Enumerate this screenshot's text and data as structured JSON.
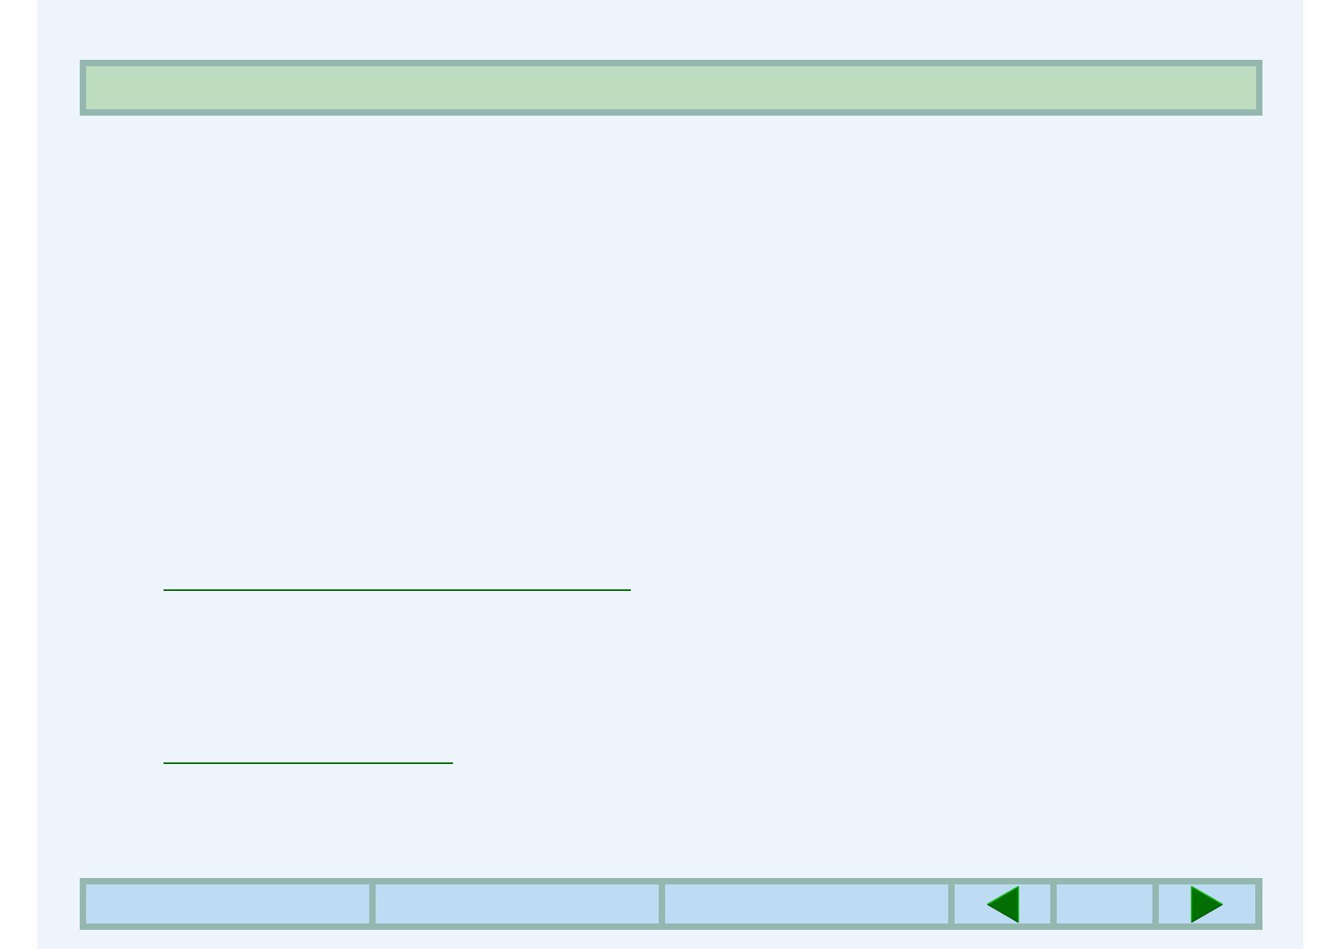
{
  "body": {
    "rules": [
      {
        "kind": "underline"
      },
      {
        "kind": "underline"
      }
    ]
  },
  "footer_bar": {
    "cells": [
      {
        "kind": "blank"
      },
      {
        "kind": "blank"
      },
      {
        "kind": "blank"
      },
      {
        "kind": "previous"
      },
      {
        "kind": "blank"
      },
      {
        "kind": "next"
      }
    ]
  }
}
